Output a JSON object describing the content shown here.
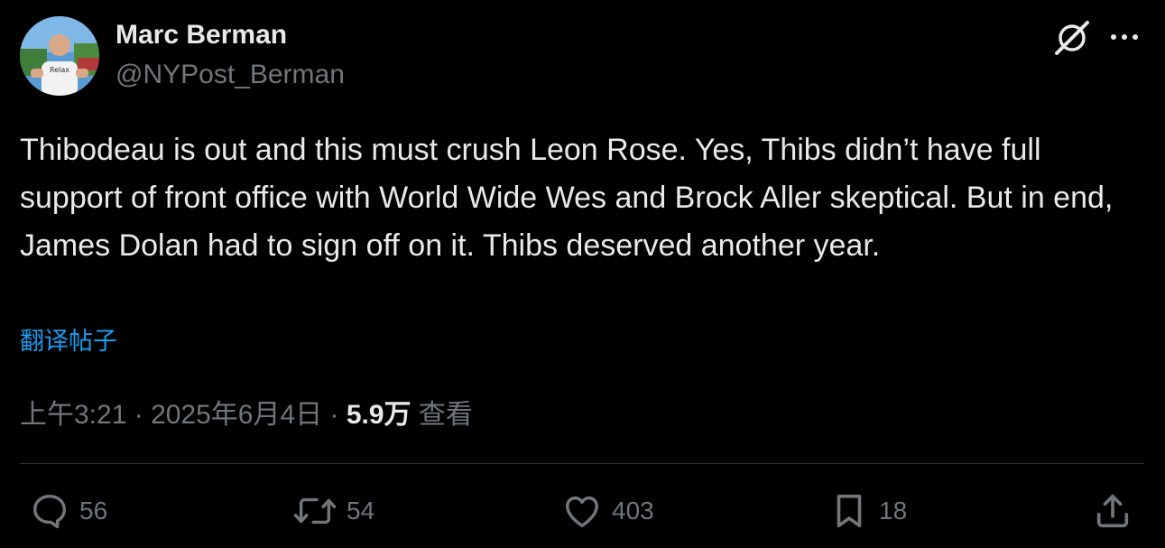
{
  "author": {
    "name": "Marc Berman",
    "handle": "@NYPost_Berman",
    "avatar_shirt_text": "Relax"
  },
  "tweet": {
    "text": "Thibodeau is out and this must crush Leon Rose. Yes, Thibs didn’t have full support of front office with World Wide Wes and Brock Aller skeptical. But in end, James Dolan had to sign off on it. Thibs deserved another year.",
    "translate_label": "翻译帖子"
  },
  "meta": {
    "time": "上午3:21",
    "separator": " · ",
    "date": "2025年6月4日",
    "views_count": "5.9万",
    "views_label": "查看"
  },
  "actions": {
    "reply_count": "56",
    "retweet_count": "54",
    "like_count": "403",
    "bookmark_count": "18"
  },
  "icons": {
    "grok": "grok-icon",
    "more": "more-icon",
    "reply": "reply-icon",
    "retweet": "retweet-icon",
    "like": "heart-icon",
    "bookmark": "bookmark-icon",
    "share": "share-icon"
  },
  "colors": {
    "background": "#000000",
    "text": "#e7e9ea",
    "secondary": "#71767b",
    "link": "#1d9bf0",
    "divider": "#2f3336"
  }
}
